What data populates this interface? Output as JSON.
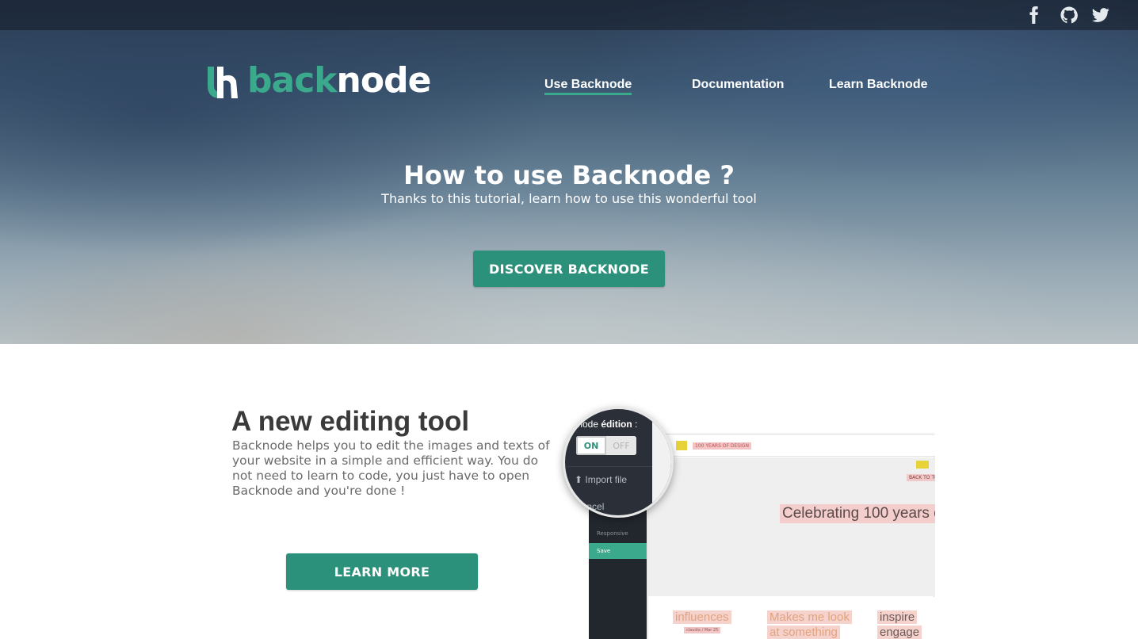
{
  "social": {
    "facebook": "facebook-icon",
    "github": "github-icon",
    "twitter": "twitter-icon"
  },
  "logo": {
    "back": "back",
    "node": "node"
  },
  "nav": {
    "items": [
      {
        "label": "Use Backnode",
        "active": true
      },
      {
        "label": "Documentation",
        "active": false
      },
      {
        "label": "Learn Backnode",
        "active": false
      }
    ]
  },
  "hero": {
    "title": "How to use Backnode ?",
    "subtitle": "Thanks to this tutorial, learn how to use this wonderful tool",
    "cta": "DISCOVER BACKNODE"
  },
  "feature": {
    "title": "A new editing tool",
    "description": "Backnode helps you to edit the images and texts of your website in a simple and efficient way. You do not need to learn to code, you just have to open Backnode and you're done !",
    "cta": "LEARN MORE"
  },
  "mockup": {
    "mode_prefix": "mode ",
    "mode_bold": "édition",
    "mode_suffix": " :",
    "toggle_on": "ON",
    "toggle_off": "OFF",
    "import_file": "Import file",
    "cancel": "Cancel",
    "responsive": "Responsive",
    "save": "Save",
    "header_tag": "100 YEARS OF DESIGN",
    "back_to_top": "BACK TO TO",
    "headline": "Celebrating 100 years o",
    "card1": "influences",
    "card1_meta": "claudia / Mar 25",
    "card2_line1": "Makes me look",
    "card2_line2": "at something",
    "card3_line1": "inspire",
    "card3_line2": "engage"
  },
  "colors": {
    "accent": "#2b917a",
    "logo_green": "#3aa98c"
  }
}
